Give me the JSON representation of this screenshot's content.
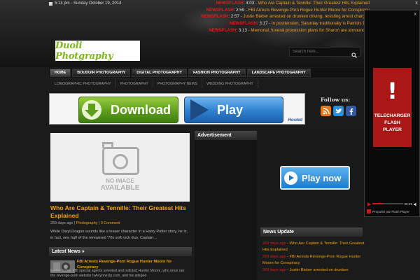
{
  "topbar": {
    "date": "5:14 pm - Sunday October 19, 2014"
  },
  "ticker": [
    {
      "tag": "NEWSFLASH",
      "time": "3:03",
      "headline": "Who Are Captain & Tennille: Their Greatest Hits Explained"
    },
    {
      "tag": "NEWSFLASH",
      "time": "2:59",
      "headline": "FBI Arrests Revenge-Porn Rogue Hunter Moore for Conspiracy"
    },
    {
      "tag": "NEWSFLASH",
      "time": "2:57",
      "headline": "Justin Bieber arrested on drunken driving, resisting arrest charges"
    },
    {
      "tag": "NEWSFLASH",
      "time": "3:17",
      "headline": "In posttension, Saturday traditionally is Patriots D..."
    },
    {
      "tag": "NEWSFLASH",
      "time": "3:13",
      "headline": "Memorial, funeral procession plans for Sharon are announced"
    }
  ],
  "logo": {
    "text": "Duoli Photgraphy"
  },
  "search": {
    "placeholder": "Search here..."
  },
  "nav_primary": [
    "HOME",
    "BOUDOIR PHOTOGRAPHY",
    "DIGITAL PHOTOGRAPHY",
    "FASHION PHOTOGRAPHY",
    "LANDSCAPE PHOTOGRAPHY"
  ],
  "nav_secondary": [
    "LOMOGRAPHIC PHOTOGRAPHY",
    "PHOTOGRAPHY",
    "PHOTOGRAPHY NEWS",
    "WEDDING PHOTOGRAPHY"
  ],
  "banner": {
    "download": "Download",
    "play": "Play",
    "hosted": "Hosted"
  },
  "follow": {
    "label": "Follow us:",
    "icons": [
      "rss-icon",
      "twitter-icon",
      "facebook-icon"
    ]
  },
  "featured": {
    "no_image_line1": "NO IMAGE",
    "no_image_line2": "AVAILABLE",
    "title": "Who Are Captain & Tennille: Their Greatest Hits Explained",
    "meta_age": "269 days ago |",
    "meta_category": "Photography",
    "meta_sep": "|",
    "meta_comments": "0 Comment",
    "excerpt": "While Daryl Dragon sounds like a lesser character in a Harry Potter story, he is, in fact, one half of the renowned '70s soft rock duo, Captain..."
  },
  "latest": {
    "heading": "Latest News »",
    "item_title": "FBI Arrests Revenge-Porn Rogue Hunter Moore for Conspiracy",
    "item_text": "Earlier today, FBI special agents arrested and indicted Hunter Moore, who once ran the revenge-porn website IsAnyoneUp.com, and his alleged"
  },
  "advertisement": {
    "heading": "Advertisement"
  },
  "ad_right": {
    "play_now": "Play now"
  },
  "news_update": {
    "heading": "News Update",
    "items": [
      {
        "ago": "269 days ago",
        "title": "Who Are Captain & Tennille: Their Greatest Hits Explained"
      },
      {
        "ago": "269 days ago",
        "title": "FBI Arrests Revenge-Porn Rogue Hunter Moore for Conspiracy"
      },
      {
        "ago": "269 days ago",
        "title": "Justin Bieber arrested on drunken"
      }
    ]
  },
  "flash_popup": {
    "exclaim": "!",
    "label_line1": "TELECHARGER",
    "label_line2": "FLASH",
    "label_line3": "PLAYER",
    "time": "00:25",
    "progress_fraction": 0.35,
    "powered": "Propulsé par Flash Player",
    "close": "x"
  },
  "colors": {
    "accent": "#f4a300",
    "alert": "#e31b1b",
    "logo_green": "#7fb81f"
  }
}
